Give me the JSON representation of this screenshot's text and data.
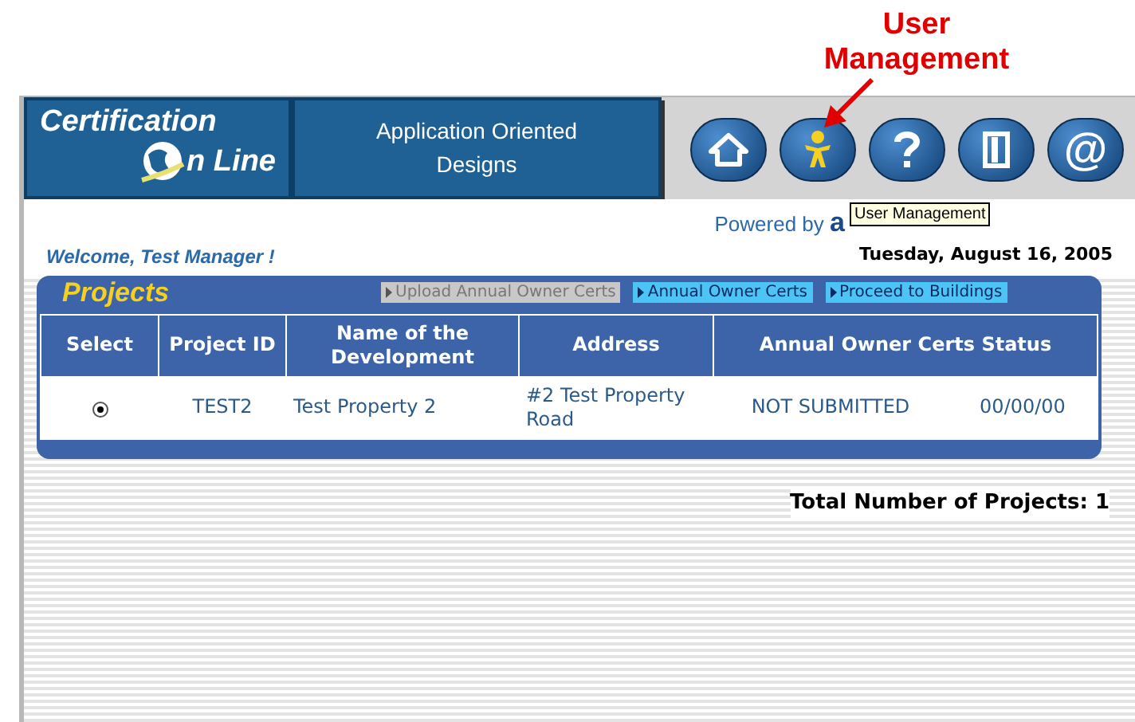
{
  "annotation": {
    "text": "User Management"
  },
  "header": {
    "logo_line1": "Certification",
    "logo_line2": "n Line",
    "company": "Application Oriented Designs",
    "nav_buttons": [
      {
        "kind": "home"
      },
      {
        "kind": "user"
      },
      {
        "kind": "help"
      },
      {
        "kind": "door"
      },
      {
        "kind": "at",
        "text": "@"
      }
    ]
  },
  "powered_by": {
    "text": "Powered by",
    "brand": "a"
  },
  "tooltip": "User Management",
  "welcome": "Welcome, Test Manager !",
  "date": "Tuesday, August 16, 2005",
  "projects": {
    "title": "Projects",
    "actions": [
      {
        "label": "Upload Annual Owner Certs",
        "disabled": true
      },
      {
        "label": "Annual Owner Certs",
        "disabled": false
      },
      {
        "label": "Proceed to Buildings",
        "disabled": false
      }
    ],
    "columns": [
      "Select",
      "Project ID",
      "Name of the Development",
      "Address",
      "Annual Owner Certs Status"
    ],
    "rows": [
      {
        "selected": true,
        "project_id": "TEST2",
        "name": "Test Property 2",
        "address": "#2 Test Property Road",
        "status": "NOT SUBMITTED",
        "date": "00/00/00"
      }
    ]
  },
  "total": "Total Number of Projects: 1"
}
